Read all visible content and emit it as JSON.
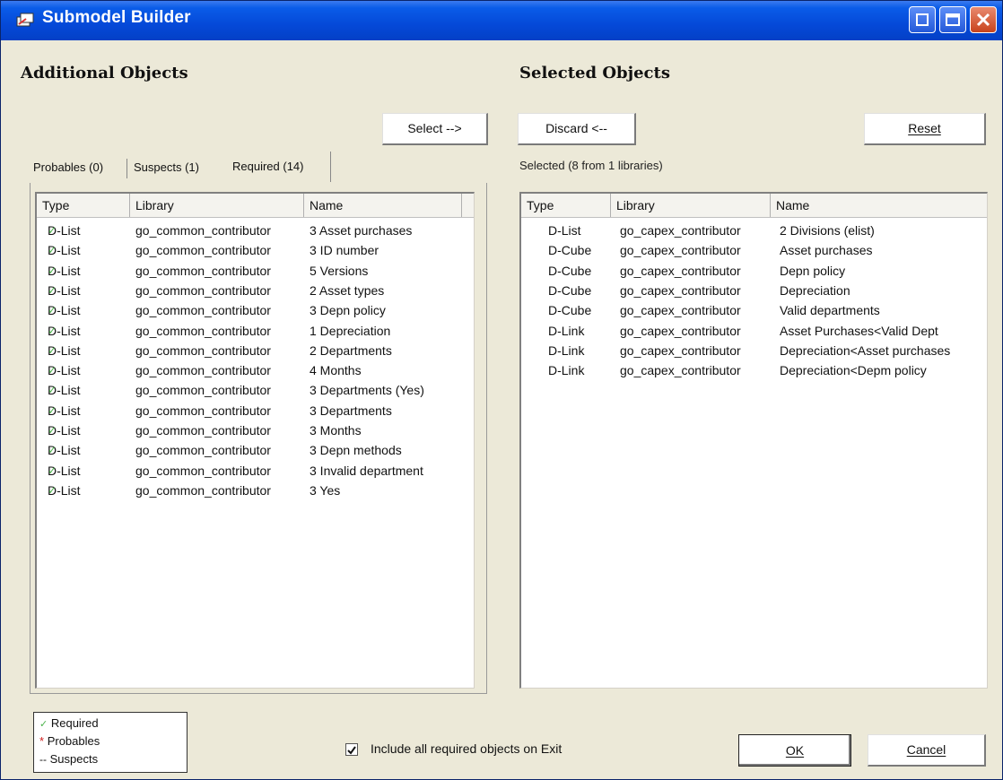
{
  "window": {
    "title": "Submodel Builder",
    "controls": [
      "minimize-icon",
      "maximize-icon",
      "close-icon"
    ]
  },
  "left": {
    "heading": "Additional Objects",
    "select_button": "Select -->",
    "tabs": [
      {
        "label": "Probables (0)",
        "active": false
      },
      {
        "label": "Suspects (1)",
        "active": false
      },
      {
        "label": "Required (14)",
        "active": true
      }
    ],
    "columns": [
      "Type",
      "Library",
      "Name"
    ],
    "rows": [
      {
        "type": "D-List",
        "library": "go_common_contributor",
        "name": "3 Asset purchases"
      },
      {
        "type": "D-List",
        "library": "go_common_contributor",
        "name": "3 ID number"
      },
      {
        "type": "D-List",
        "library": "go_common_contributor",
        "name": "5 Versions"
      },
      {
        "type": "D-List",
        "library": "go_common_contributor",
        "name": "2 Asset types"
      },
      {
        "type": "D-List",
        "library": "go_common_contributor",
        "name": "3 Depn policy"
      },
      {
        "type": "D-List",
        "library": "go_common_contributor",
        "name": "1 Depreciation"
      },
      {
        "type": "D-List",
        "library": "go_common_contributor",
        "name": "2 Departments"
      },
      {
        "type": "D-List",
        "library": "go_common_contributor",
        "name": "4 Months"
      },
      {
        "type": "D-List",
        "library": "go_common_contributor",
        "name": "3 Departments (Yes)"
      },
      {
        "type": "D-List",
        "library": "go_common_contributor",
        "name": "3 Departments"
      },
      {
        "type": "D-List",
        "library": "go_common_contributor",
        "name": "3 Months"
      },
      {
        "type": "D-List",
        "library": "go_common_contributor",
        "name": "3 Depn methods"
      },
      {
        "type": "D-List",
        "library": "go_common_contributor",
        "name": "3 Invalid department"
      },
      {
        "type": "D-List",
        "library": "go_common_contributor",
        "name": "3 Yes"
      }
    ]
  },
  "right": {
    "heading": "Selected Objects",
    "discard_button": "Discard <--",
    "reset_button": "Reset",
    "summary": "Selected (8 from 1 libraries)",
    "columns": [
      "Type",
      "Library",
      "Name"
    ],
    "rows": [
      {
        "type": "D-List",
        "library": "go_capex_contributor",
        "name": "2 Divisions (elist)"
      },
      {
        "type": "D-Cube",
        "library": "go_capex_contributor",
        "name": "Asset purchases"
      },
      {
        "type": "D-Cube",
        "library": "go_capex_contributor",
        "name": "Depn policy"
      },
      {
        "type": "D-Cube",
        "library": "go_capex_contributor",
        "name": "Depreciation"
      },
      {
        "type": "D-Cube",
        "library": "go_capex_contributor",
        "name": "Valid departments"
      },
      {
        "type": "D-Link",
        "library": "go_capex_contributor",
        "name": "Asset Purchases<Valid Dept"
      },
      {
        "type": "D-Link",
        "library": "go_capex_contributor",
        "name": "Depreciation<Asset purchases"
      },
      {
        "type": "D-Link",
        "library": "go_capex_contributor",
        "name": "Depreciation<Depm policy"
      }
    ]
  },
  "legend": {
    "items": [
      {
        "marker": "✓",
        "label": "Required",
        "color": "#4cb34c"
      },
      {
        "marker": "*",
        "label": "Probables",
        "color": "#d02020"
      },
      {
        "marker": "--",
        "label": "Suspects",
        "color": "#111111"
      }
    ]
  },
  "footer": {
    "include_checkbox_label": "Include all required objects on Exit",
    "include_checked": true,
    "ok_button": "OK",
    "cancel_button": "Cancel"
  },
  "colors": {
    "titlebar": "#0549d8",
    "dialog_bg": "#ece9d8",
    "required_check": "#4cb34c"
  }
}
